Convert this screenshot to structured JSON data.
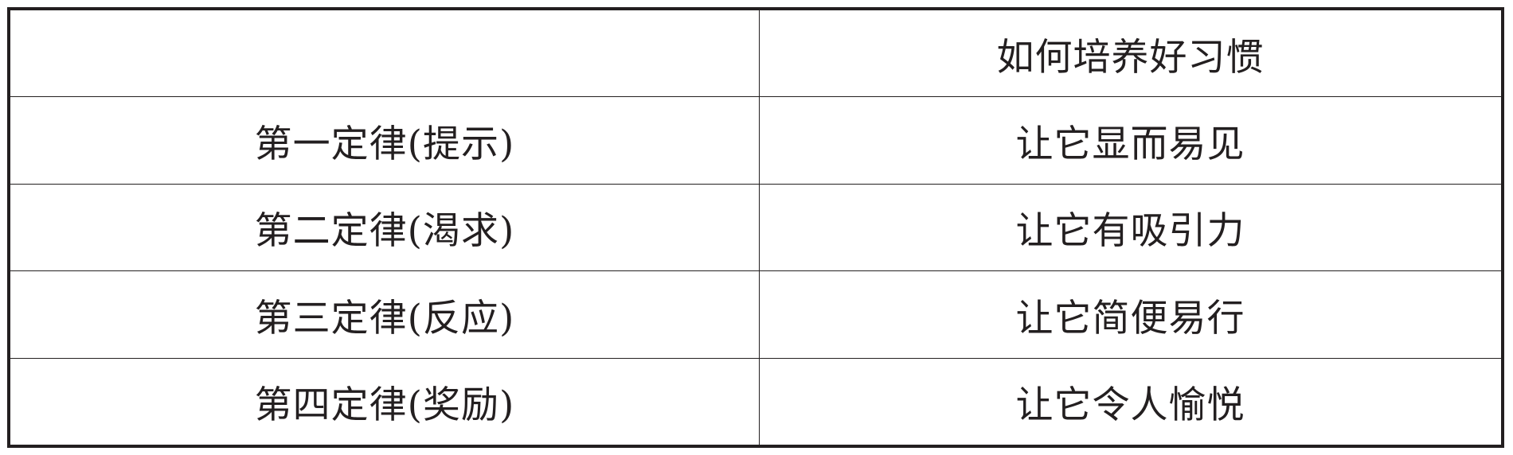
{
  "table": {
    "header": [
      "",
      "如何培养好习惯"
    ],
    "rows": [
      [
        "第一定律(提示)",
        "让它显而易见"
      ],
      [
        "第二定律(渴求)",
        "让它有吸引力"
      ],
      [
        "第三定律(反应)",
        "让它简便易行"
      ],
      [
        "第四定律(奖励)",
        "让它令人愉悦"
      ]
    ]
  }
}
